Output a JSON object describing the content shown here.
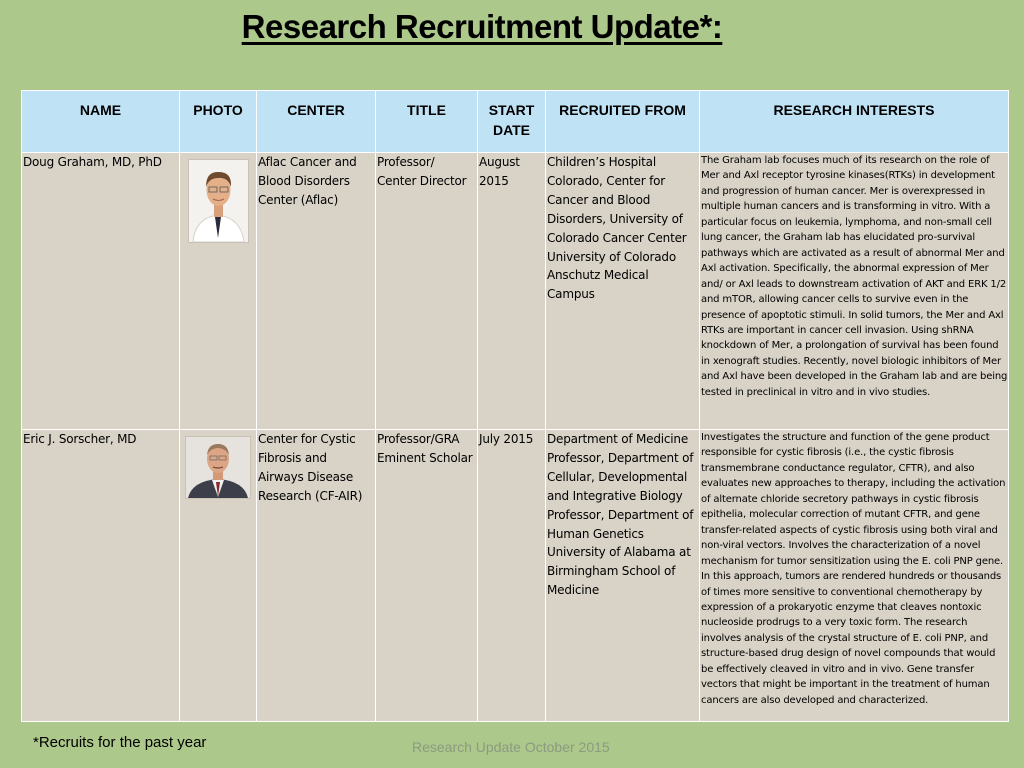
{
  "title": "Research Recruitment Update*:",
  "table": {
    "headers": {
      "name": "NAME",
      "photo": "PHOTO",
      "center": "CENTER",
      "title": "TITLE",
      "start_date": "START DATE",
      "recruited_from": "RECRUITED FROM",
      "research_interests": "RESEARCH INTERESTS"
    },
    "rows": [
      {
        "name": "Doug Graham, MD, PhD",
        "photo_icon": "portrait-photo",
        "center": "Aflac Cancer and Blood Disorders Center (Aflac)",
        "title": "Professor/ Center Director",
        "start_date": "August 2015",
        "recruited_from": "Children’s Hospital Colorado, Center for Cancer and Blood Disorders, University of Colorado Cancer Center University of Colorado Anschutz Medical Campus",
        "research_interests": "The Graham lab focuses much of its research on the role of Mer and Axl receptor tyrosine kinases(RTKs) in development and progression of human cancer. Mer is overexpressed in multiple human cancers and is transforming in vitro. With a particular focus on leukemia, lymphoma, and non-small cell lung cancer, the Graham lab has elucidated pro-survival pathways which are activated as a result of abnormal Mer and Axl activation. Specifically, the abnormal expression of Mer and/ or Axl leads to downstream activation of AKT and ERK 1/2 and mTOR, allowing cancer cells to survive even in the presence of apoptotic stimuli. In solid tumors, the Mer and Axl RTKs are important in cancer cell invasion. Using shRNA knockdown of Mer, a prolongation of survival has been found in xenograft studies. Recently, novel biologic inhibitors of Mer and Axl have been developed in the Graham lab and are being tested in preclinical in vitro and in vivo studies."
      },
      {
        "name": "Eric J. Sorscher, MD",
        "photo_icon": "portrait-photo",
        "center": "Center for Cystic Fibrosis and Airways Disease Research (CF-AIR)",
        "title": "Professor/GRA Eminent Scholar",
        "start_date": "July 2015",
        "recruited_from": "Department of Medicine Professor, Department of Cellular, Developmental and Integrative Biology Professor, Department of Human Genetics University of Alabama at Birmingham School of Medicine",
        "research_interests": "Investigates the structure and function of the gene product responsible for cystic fibrosis (i.e., the cystic fibrosis transmembrane conductance regulator, CFTR), and also evaluates new approaches to therapy, including the activation of alternate chloride secretory pathways in cystic fibrosis epithelia, molecular correction of mutant CFTR, and gene transfer-related aspects of cystic fibrosis using both viral and non-viral vectors.  Involves the characterization of a novel mechanism for tumor sensitization using the E. coli PNP gene. In this approach, tumors are rendered hundreds or thousands of times more sensitive to conventional chemotherapy by expression of a prokaryotic enzyme that cleaves nontoxic nucleoside prodrugs to a very toxic form. The research involves analysis of the crystal structure of E. coli PNP, and structure-based drug design of novel compounds that would be effectively cleaved in vitro and in vivo. Gene transfer vectors that might be important in the treatment of human cancers are also developed and characterized."
      }
    ]
  },
  "footnote": "*Recruits for the past year",
  "footer": "Research Update October 2015",
  "colors": {
    "background": "#acc88a",
    "header_fill": "#bfe2f5",
    "cell_fill": "#d9d3c7",
    "footer_text": "#8c9a80"
  }
}
